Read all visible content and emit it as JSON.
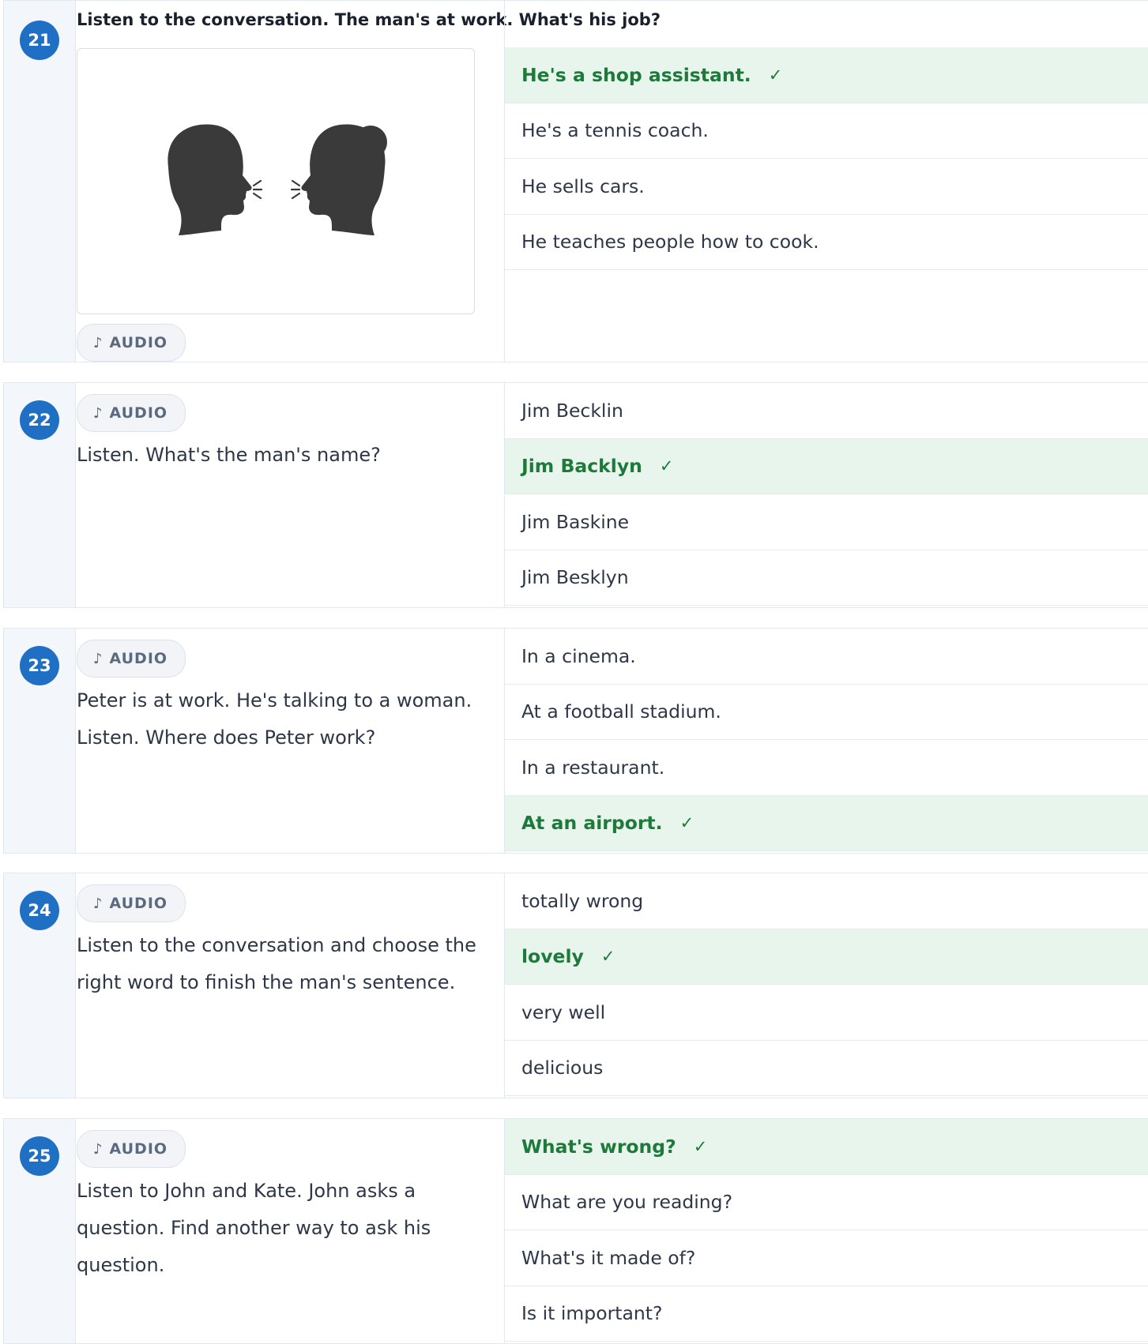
{
  "audio_label": "AUDIO",
  "audio_icon": "music-note-icon",
  "check_mark": "✓",
  "colors": {
    "badge": "#1f6fc4",
    "correct_bg": "#e8f5ec",
    "correct_text": "#1e7a3a"
  },
  "questions": [
    {
      "number": "21",
      "prompt": "Listen to the conversation. The man's at work. What's his job?",
      "image": "two-people-talking-icon",
      "options": [
        {
          "text": "He's a shop assistant.",
          "correct": true
        },
        {
          "text": "He's a tennis coach.",
          "correct": false
        },
        {
          "text": "He sells cars.",
          "correct": false
        },
        {
          "text": "He teaches people how to cook.",
          "correct": false
        }
      ]
    },
    {
      "number": "22",
      "prompt": "Listen. What's the man's name?",
      "options": [
        {
          "text": "Jim Becklin",
          "correct": false
        },
        {
          "text": "Jim Backlyn",
          "correct": true
        },
        {
          "text": "Jim Baskine",
          "correct": false
        },
        {
          "text": "Jim Besklyn",
          "correct": false
        }
      ]
    },
    {
      "number": "23",
      "prompt": "Peter is at work. He's talking to a woman. Listen. Where does Peter work?",
      "options": [
        {
          "text": "In a cinema.",
          "correct": false
        },
        {
          "text": "At a football stadium.",
          "correct": false
        },
        {
          "text": "In a restaurant.",
          "correct": false
        },
        {
          "text": "At an airport.",
          "correct": true
        }
      ]
    },
    {
      "number": "24",
      "prompt": "Listen to the conversation and choose the right word to finish the man's sentence.",
      "options": [
        {
          "text": "totally wrong",
          "correct": false
        },
        {
          "text": "lovely",
          "correct": true
        },
        {
          "text": "very well",
          "correct": false
        },
        {
          "text": "delicious",
          "correct": false
        }
      ]
    },
    {
      "number": "25",
      "prompt": "Listen to John and Kate. John asks a question. Find another way to ask his question.",
      "options": [
        {
          "text": "What's wrong?",
          "correct": true
        },
        {
          "text": "What are you reading?",
          "correct": false
        },
        {
          "text": "What's it made of?",
          "correct": false
        },
        {
          "text": "Is it important?",
          "correct": false
        }
      ]
    }
  ]
}
